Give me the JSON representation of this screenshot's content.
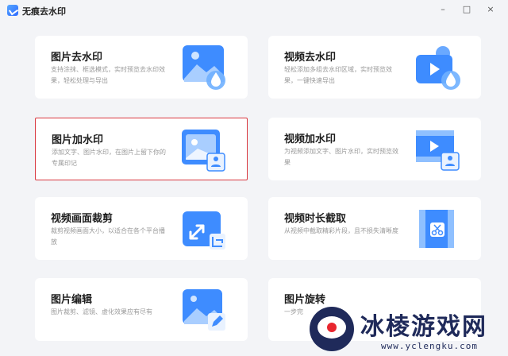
{
  "app": {
    "title": "无痕去水印"
  },
  "window_controls": {
    "minimize": "–",
    "maximize": "□",
    "close": "×"
  },
  "cards": [
    {
      "title": "图片去水印",
      "desc": "支持涂抹、框选模式，实时预览去水印效果，轻松处理与导出",
      "icon": "image-remove-watermark-icon"
    },
    {
      "title": "视频去水印",
      "desc": "轻松添加多组去水印区域，实时预览效果，一键快速导出",
      "icon": "video-remove-watermark-icon"
    },
    {
      "title": "图片加水印",
      "desc": "添加文字、图片水印，在图片上留下你的专属印记",
      "icon": "image-add-watermark-icon",
      "selected": true
    },
    {
      "title": "视频加水印",
      "desc": "为视频添加文字、图片水印，实时预览效果",
      "icon": "video-add-watermark-icon"
    },
    {
      "title": "视频画面裁剪",
      "desc": "裁剪视频画面大小，以适合在各个平台播放",
      "icon": "video-crop-icon"
    },
    {
      "title": "视频时长截取",
      "desc": "从视频中截取精彩片段，且不损失清晰度",
      "icon": "video-trim-icon"
    },
    {
      "title": "图片编辑",
      "desc": "图片裁剪、滤镜、虚化效果应有尽有",
      "icon": "image-edit-icon"
    },
    {
      "title": "图片旋转",
      "desc": "一步完",
      "icon": "image-rotate-icon"
    }
  ],
  "watermark": {
    "text": "冰棱游戏网",
    "url": "www.yclengku.com"
  },
  "colors": {
    "accent": "#3b8bff",
    "selected_border": "#d9363e",
    "background": "#f3f4f7"
  }
}
